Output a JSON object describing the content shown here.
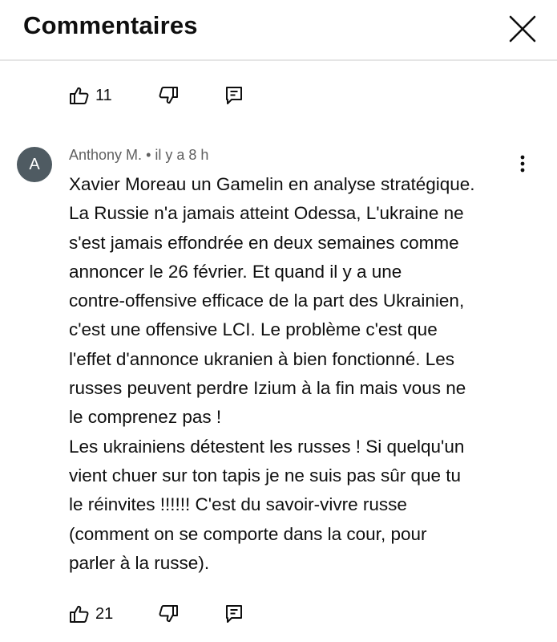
{
  "header": {
    "title": "Commentaires",
    "close_icon": "close-icon"
  },
  "previous_comment": {
    "like_count": "11",
    "icons": [
      "thumb-up-icon",
      "thumb-down-icon",
      "reply-icon"
    ]
  },
  "comment": {
    "avatar_letter": "A",
    "avatar_color": "#4f5b62",
    "author": "Anthony M.",
    "separator": "•",
    "time": "il y a 8 h",
    "lines": [
      "Xavier Moreau un Gamelin en analyse stratégique.",
      "La Russie n'a jamais atteint Odessa, L'ukraine ne",
      "s'est jamais effondrée en deux semaines comme",
      "annoncer le 26 février. Et quand il y a une",
      "contre-offensive efficace de la part des Ukrainien,",
      "c'est une offensive LCI. Le problème c'est que",
      "l'effet d'annonce ukranien à bien fonctionné. Les",
      "russes peuvent perdre Izium à la fin mais vous ne",
      "le comprenez pas !",
      "Les ukrainiens détestent les russes ! Si quelqu'un",
      "vient chuer sur ton tapis je ne suis pas sûr que tu",
      "le réinvites !!!!!! C'est du savoir-vivre russe",
      "(comment on se comporte dans la cour, pour",
      "parler à la russe)."
    ],
    "like_count": "21",
    "menu_icon": "more-vert-icon"
  }
}
